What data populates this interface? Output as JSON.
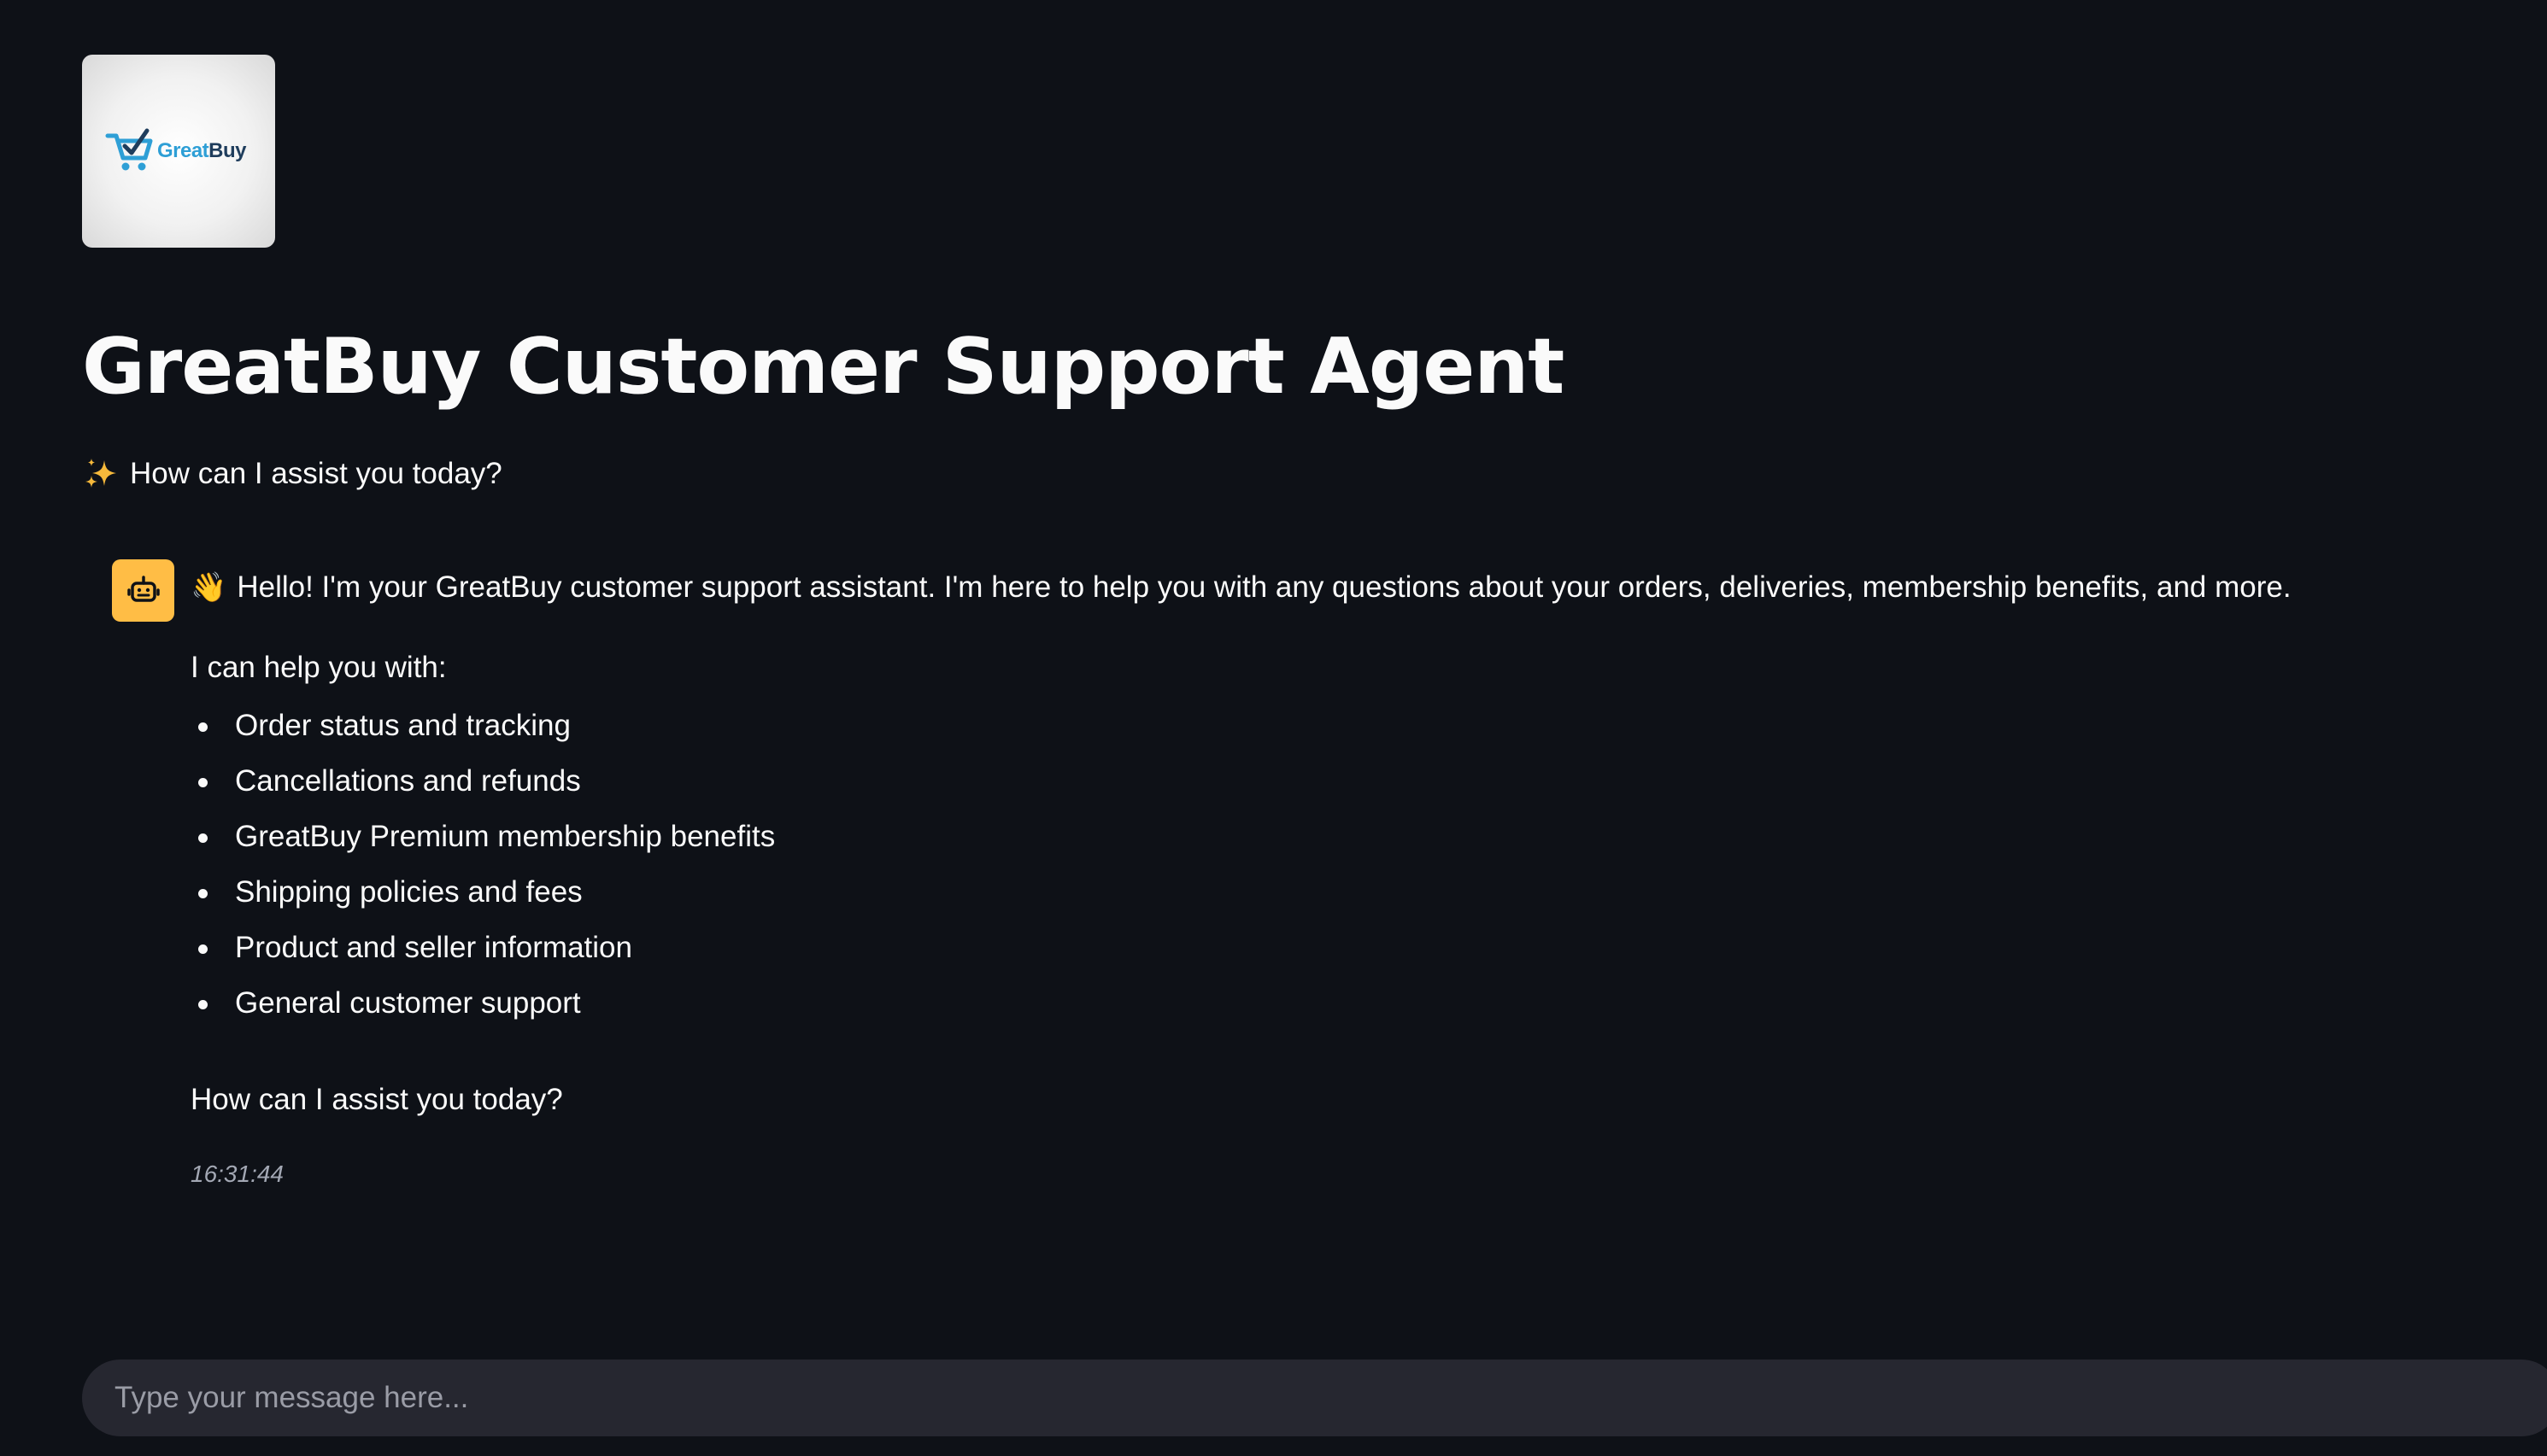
{
  "logo": {
    "text_part1": "Great",
    "text_part2": "Buy",
    "colors": {
      "great": "#2e9fd6",
      "buy": "#1f3d5c",
      "cart": "#2e9fd6"
    }
  },
  "header": {
    "title": "GreatBuy Customer Support Agent",
    "subtitle": "How can I assist you today?",
    "subtitle_icon": "sparkle-icon"
  },
  "chat": {
    "messages": [
      {
        "role": "assistant",
        "avatar_icon": "robot-icon",
        "avatar_color": "#ffbd45",
        "greeting_icon": "waving-hand-icon",
        "greeting": "Hello! I'm your GreatBuy customer support assistant. I'm here to help you with any questions about your orders, deliveries, membership benefits, and more.",
        "intro": "I can help you with:",
        "items": [
          "Order status and tracking",
          "Cancellations and refunds",
          "GreatBuy Premium membership benefits",
          "Shipping policies and fees",
          "Product and seller information",
          "General customer support"
        ],
        "closing": "How can I assist you today?",
        "timestamp": "16:31:44"
      }
    ]
  },
  "input": {
    "placeholder": "Type your message here...",
    "value": ""
  },
  "theme": {
    "background": "#0e1117",
    "text": "#fafafa",
    "input_background": "#262730"
  }
}
